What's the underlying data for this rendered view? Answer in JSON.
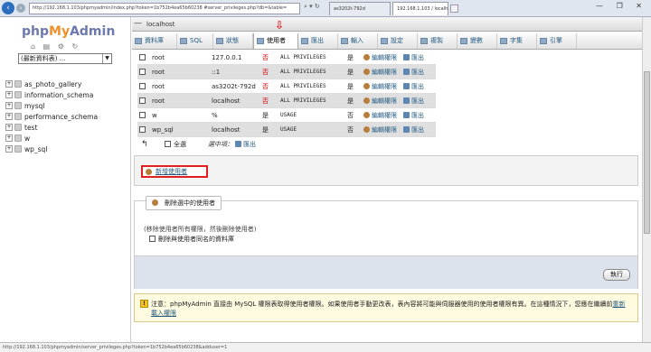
{
  "browser": {
    "url": "http://192.168.1.103/phpmyadmin/index.php?token=1b752b4ea65b60238 #server_privileges.php?db=&table=",
    "url_controls": "⌕ ▾ ↻",
    "tabs": [
      {
        "label": "as3202t-792d"
      },
      {
        "label": "192.168.1.103 / localhost |..."
      }
    ],
    "window_controls": "— ❐ ✕"
  },
  "sidebar": {
    "logo_php": "php",
    "logo_my": "My",
    "logo_admin": "Admin",
    "icon_row": "⌂ ▤ ⚙ ↻",
    "db_select": "(最新資料表) ...",
    "databases": [
      {
        "name": "as_photo_gallery"
      },
      {
        "name": "information_schema"
      },
      {
        "name": "mysql"
      },
      {
        "name": "performance_schema"
      },
      {
        "name": "test"
      },
      {
        "name": "w"
      },
      {
        "name": "wp_sql"
      }
    ]
  },
  "server": {
    "label": "localhost"
  },
  "tabs": [
    {
      "label": "資料庫"
    },
    {
      "label": "SQL"
    },
    {
      "label": "狀態"
    },
    {
      "label": "使用者"
    },
    {
      "label": "匯出"
    },
    {
      "label": "輸入"
    },
    {
      "label": "設定"
    },
    {
      "label": "複製"
    },
    {
      "label": "變數"
    },
    {
      "label": "字集"
    },
    {
      "label": "引擎"
    }
  ],
  "active_tab": "使用者",
  "users": [
    {
      "user": "root",
      "host": "127.0.0.1",
      "password": "否",
      "privileges": "ALL PRIVILEGES",
      "grant": "是",
      "edit": "編輯權限",
      "export": "匯出"
    },
    {
      "user": "root",
      "host": "::1",
      "password": "否",
      "privileges": "ALL PRIVILEGES",
      "grant": "是",
      "edit": "編輯權限",
      "export": "匯出"
    },
    {
      "user": "root",
      "host": "as3202t-792d",
      "password": "否",
      "privileges": "ALL PRIVILEGES",
      "grant": "是",
      "edit": "編輯權限",
      "export": "匯出"
    },
    {
      "user": "root",
      "host": "localhost",
      "password": "否",
      "privileges": "ALL PRIVILEGES",
      "grant": "是",
      "edit": "編輯權限",
      "export": "匯出"
    },
    {
      "user": "w",
      "host": "%",
      "password": "是",
      "privileges": "USAGE",
      "grant": "否",
      "edit": "編輯權限",
      "export": "匯出"
    },
    {
      "user": "wp_sql",
      "host": "localhost",
      "password": "是",
      "privileges": "USAGE",
      "grant": "否",
      "edit": "編輯權限",
      "export": "匯出"
    }
  ],
  "selection": {
    "select_all": "全選",
    "with_selected": "選中項：",
    "export": "匯出"
  },
  "add_user": "新增使用者",
  "delete_section": {
    "legend": "刪除選中的使用者",
    "note": "(移除使用者所有權限，然後刪除使用者)",
    "checkbox_label": "刪除與使用者同名的資料庫",
    "execute": "執行"
  },
  "notice": {
    "text": "注意：phpMyAdmin 直接由 MySQL 權限表取得使用者權限。如果使用者手動更改表，表內容將可能與伺服器使用的使用者權限有異。在這種情況下，您應在繼續前",
    "link": "重新載入權限"
  },
  "status_bar": "http://192.168.1.103/phpmyadmin/server_privileges.php?token=1b752b4ea65b60238&adduser=1"
}
